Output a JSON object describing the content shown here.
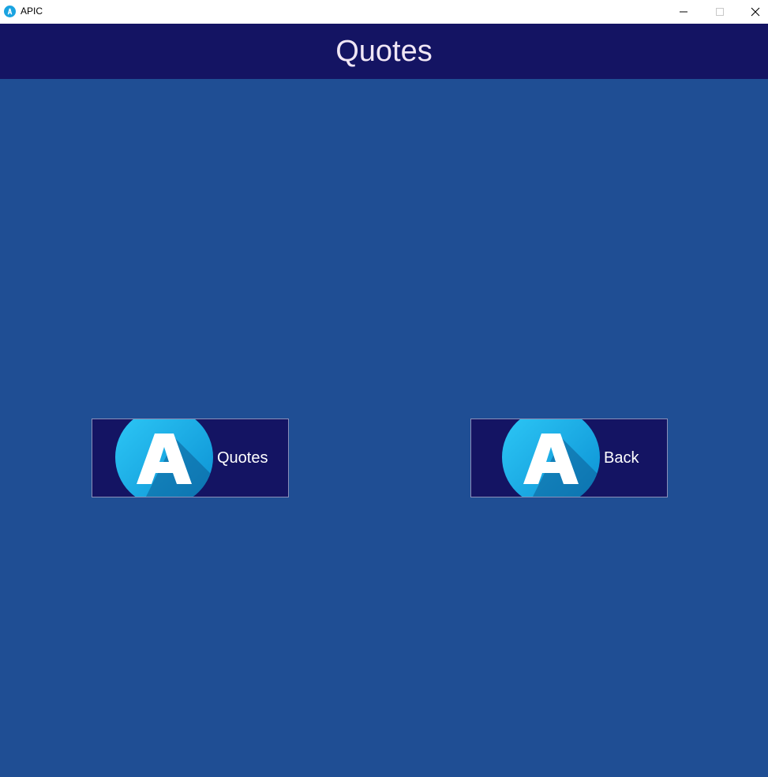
{
  "window": {
    "app_title": "APIC",
    "controls": {
      "minimize_icon": "minimize-icon",
      "maximize_icon": "maximize-icon",
      "close_icon": "close-icon"
    }
  },
  "header": {
    "title": "Quotes"
  },
  "buttons": {
    "quotes": {
      "label": "Quotes",
      "icon": "apic-logo-icon"
    },
    "back": {
      "label": "Back",
      "icon": "apic-logo-icon"
    }
  },
  "colors": {
    "background": "#1f4e94",
    "header_bg": "#141463",
    "button_bg": "#141463",
    "logo_light": "#29c4f5",
    "logo_dark": "#0a8fd0",
    "header_text": "#f0e6f5"
  }
}
